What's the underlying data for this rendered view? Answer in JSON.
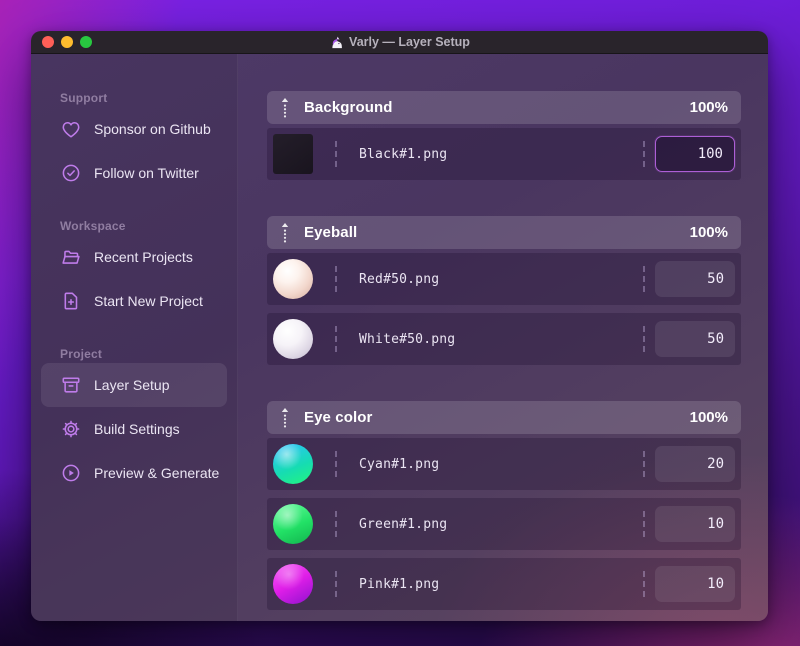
{
  "window": {
    "title": "Varly — Layer Setup",
    "app_icon": "unicorn-icon",
    "traffic_lights": [
      "close",
      "minimize",
      "zoom"
    ]
  },
  "sidebar": {
    "sections": [
      {
        "label": "Support",
        "items": [
          {
            "label": "Sponsor on Github",
            "icon": "heart-icon"
          },
          {
            "label": "Follow on Twitter",
            "icon": "badge-check-icon"
          }
        ]
      },
      {
        "label": "Workspace",
        "items": [
          {
            "label": "Recent Projects",
            "icon": "folder-open-icon"
          },
          {
            "label": "Start New Project",
            "icon": "document-plus-icon"
          }
        ]
      },
      {
        "label": "Project",
        "items": [
          {
            "label": "Layer Setup",
            "icon": "archive-box-icon",
            "active": true
          },
          {
            "label": "Build Settings",
            "icon": "gear-icon"
          },
          {
            "label": "Preview & Generate",
            "icon": "play-circle-icon"
          }
        ]
      }
    ]
  },
  "layers": {
    "groups": [
      {
        "name": "Background",
        "weight": "100%",
        "rows": [
          {
            "file": "Black#1.png",
            "value": "100",
            "thumb": "black-square",
            "focused": true
          }
        ]
      },
      {
        "name": "Eyeball",
        "weight": "100%",
        "rows": [
          {
            "file": "Red#50.png",
            "value": "50",
            "thumb": "red-sphere"
          },
          {
            "file": "White#50.png",
            "value": "50",
            "thumb": "white-sphere"
          }
        ]
      },
      {
        "name": "Eye color",
        "weight": "100%",
        "rows": [
          {
            "file": "Cyan#1.png",
            "value": "20",
            "thumb": "cyan-sphere"
          },
          {
            "file": "Green#1.png",
            "value": "10",
            "thumb": "green-sphere"
          },
          {
            "file": "Pink#1.png",
            "value": "10",
            "thumb": "pink-sphere"
          }
        ]
      }
    ]
  },
  "colors": {
    "accent_icon": "#bf7cea",
    "focus_border": "#ad5fd6",
    "titlebar_bg": "#29242b",
    "traffic_red": "#ff5f57",
    "traffic_yellow": "#febc2e",
    "traffic_green": "#28c840",
    "thumb_black": "#1f1a24",
    "sphere_red": [
      "#ffffff",
      "#d3aa9d"
    ],
    "sphere_white": [
      "#ffffff",
      "#b8b0c5"
    ],
    "sphere_cyan": [
      "#2cc4f6",
      "#22f382"
    ],
    "sphere_green": [
      "#62f89a",
      "#12b44e"
    ],
    "sphere_pink": [
      "#f562f5",
      "#8f12cf"
    ]
  }
}
